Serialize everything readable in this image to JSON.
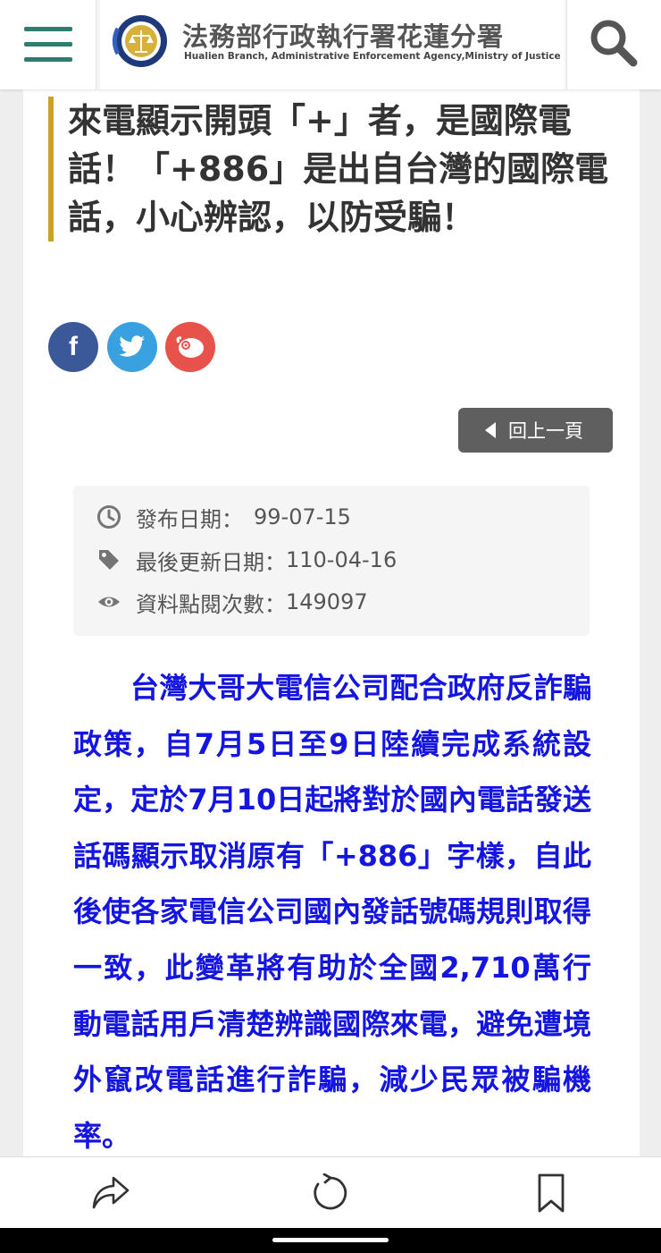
{
  "header": {
    "site_name_zh": "法務部行政執行署花蓮分署",
    "site_name_en": "Hualien Branch, Administrative Enforcement Agency,Ministry of Justice"
  },
  "article": {
    "title": "來電顯示開頭「+」者，是國際電話！「+886」是出自台灣的國際電話，小心辨認，以防受騙！",
    "body": "台灣大哥大電信公司配合政府反詐騙政策，自7月5日至9日陸續完成系統設定，定於7月10日起將對於國內電話發送話碼顯示取消原有「+886」字樣，自此後使各家電信公司國內發話號碼規則取得一致，此變革將有助於全國2,710萬行動電話用戶清楚辨識國際來電，避免遭境外竄改電話進行詐騙，減少民眾被騙機率。"
  },
  "share": {
    "facebook_glyph": "f"
  },
  "back_button": {
    "label": "回上一頁"
  },
  "meta": {
    "publish_label": "發布日期：",
    "publish_value": "99-07-15",
    "updated_label": "最後更新日期：",
    "updated_value": "110-04-16",
    "views_label": "資料點閱次數：",
    "views_value": "149097"
  },
  "colors": {
    "accent_green": "#2e7d6f",
    "title_bar_gold": "#c9a227",
    "body_text_blue": "#1515e0",
    "facebook": "#3b5998",
    "twitter": "#3aa1e0",
    "plurk": "#e7524a"
  },
  "icons": [
    "menu-icon",
    "logo-seal-icon",
    "search-icon",
    "facebook-icon",
    "twitter-icon",
    "plurk-icon",
    "back-arrow-icon",
    "clock-icon",
    "tag-icon",
    "eye-icon",
    "share-icon",
    "refresh-icon",
    "bookmark-icon"
  ]
}
